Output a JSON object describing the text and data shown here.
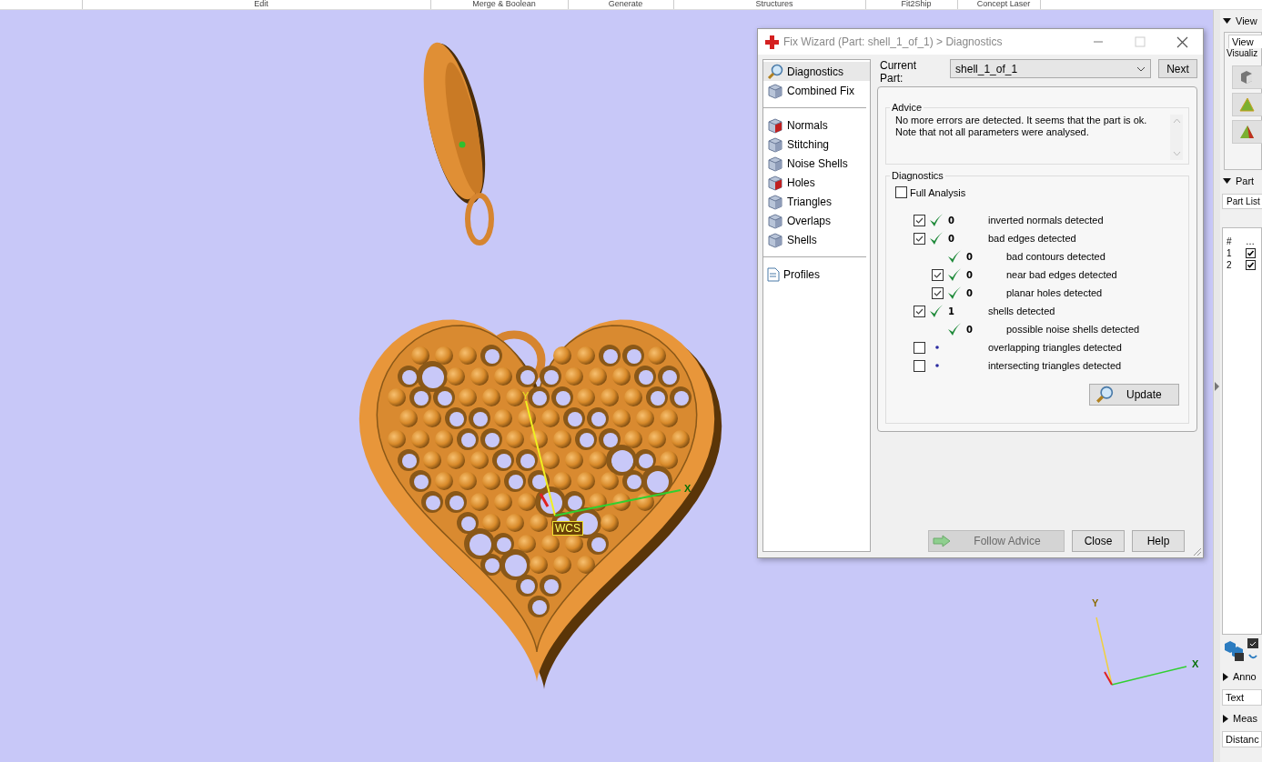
{
  "menu_bar": {
    "items": [
      "Edit",
      "Merge & Boolean",
      "Generate",
      "Structures",
      "Fit2Ship",
      "Concept Laser"
    ]
  },
  "viewport": {
    "wcs_label": "WCS",
    "axis_x": "X",
    "axis_y": "Y",
    "triad_x": "X",
    "triad_y": "Y"
  },
  "dialog": {
    "title": "Fix Wizard (Part: shell_1_of_1) > Diagnostics",
    "nav_groups": [
      {
        "items": [
          {
            "label": "Diagnostics",
            "selected": true
          },
          {
            "label": "Combined Fix",
            "selected": false
          }
        ]
      },
      {
        "items": [
          {
            "label": "Normals",
            "selected": false
          },
          {
            "label": "Stitching",
            "selected": false
          },
          {
            "label": "Noise Shells",
            "selected": false
          },
          {
            "label": "Holes",
            "selected": false
          },
          {
            "label": "Triangles",
            "selected": false
          },
          {
            "label": "Overlaps",
            "selected": false
          },
          {
            "label": "Shells",
            "selected": false
          }
        ]
      },
      {
        "items": [
          {
            "label": "Profiles",
            "selected": false
          }
        ]
      }
    ],
    "current_part_label": "Current Part:",
    "current_part": "shell_1_of_1",
    "next": "Next",
    "advice_title": "Advice",
    "advice_text": "No more errors are detected. It seems that the part is ok. Note that not all parameters were analysed.",
    "diagnostics_title": "Diagnostics",
    "full_analysis": {
      "label": "Full Analysis",
      "checked": false
    },
    "checks": [
      {
        "kind": "checkbox",
        "checked": true,
        "passed": true,
        "count": "0",
        "label": "inverted normals detected"
      },
      {
        "kind": "checkbox",
        "checked": true,
        "passed": true,
        "count": "0",
        "label": "bad edges detected",
        "children": [
          {
            "kind": "plain",
            "passed": true,
            "count": "0",
            "label": "bad contours detected"
          },
          {
            "kind": "checkbox",
            "checked": true,
            "passed": true,
            "count": "0",
            "label": "near bad edges detected"
          },
          {
            "kind": "checkbox",
            "checked": true,
            "passed": true,
            "count": "0",
            "label": "planar holes detected"
          }
        ]
      },
      {
        "kind": "checkbox",
        "checked": true,
        "passed": true,
        "count": "1",
        "label": "shells detected",
        "children": [
          {
            "kind": "plain",
            "passed": true,
            "count": "0",
            "label": "possible noise shells detected"
          }
        ]
      },
      {
        "kind": "checkbox",
        "checked": false,
        "passed": false,
        "label": "overlapping triangles detected"
      },
      {
        "kind": "checkbox",
        "checked": false,
        "passed": false,
        "label": "intersecting triangles detected"
      }
    ],
    "update": "Update",
    "buttons": [
      {
        "label": "Follow Advice",
        "disabled": true
      },
      {
        "label": "Close",
        "disabled": false
      },
      {
        "label": "Help",
        "disabled": false
      }
    ]
  },
  "right_panel": {
    "view_header": "View",
    "view_tab": "View",
    "visualize_group": "Visualiz",
    "part_header": "Part",
    "part_tab": "Part List",
    "columns": [
      "#",
      "…"
    ],
    "rows": [
      {
        "index": "1",
        "checked": true
      },
      {
        "index": "2",
        "checked": true
      }
    ],
    "annotations_header": "Anno",
    "text_tab": "Text",
    "measure_header": "Meas",
    "distance_tab": "Distanc"
  }
}
